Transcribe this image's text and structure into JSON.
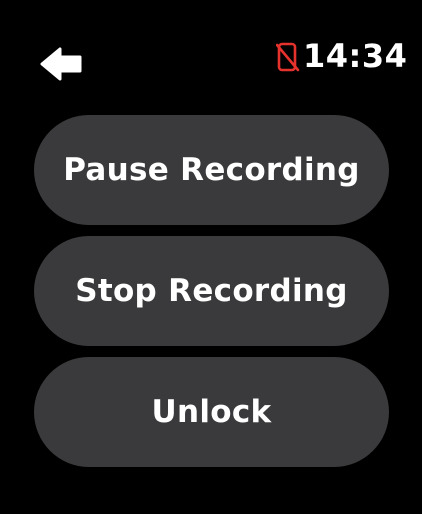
{
  "status_bar": {
    "back_icon": "arrow-left-icon",
    "phone_disconnected_icon": "phone-disconnected-icon",
    "phone_icon_color": "#e5322d",
    "time": "14:34"
  },
  "menu": {
    "items": [
      {
        "label": "Pause Recording"
      },
      {
        "label": "Stop Recording"
      },
      {
        "label": "Unlock"
      }
    ]
  },
  "colors": {
    "background": "#000000",
    "button_fill": "#3a3a3c",
    "text": "#ffffff"
  }
}
